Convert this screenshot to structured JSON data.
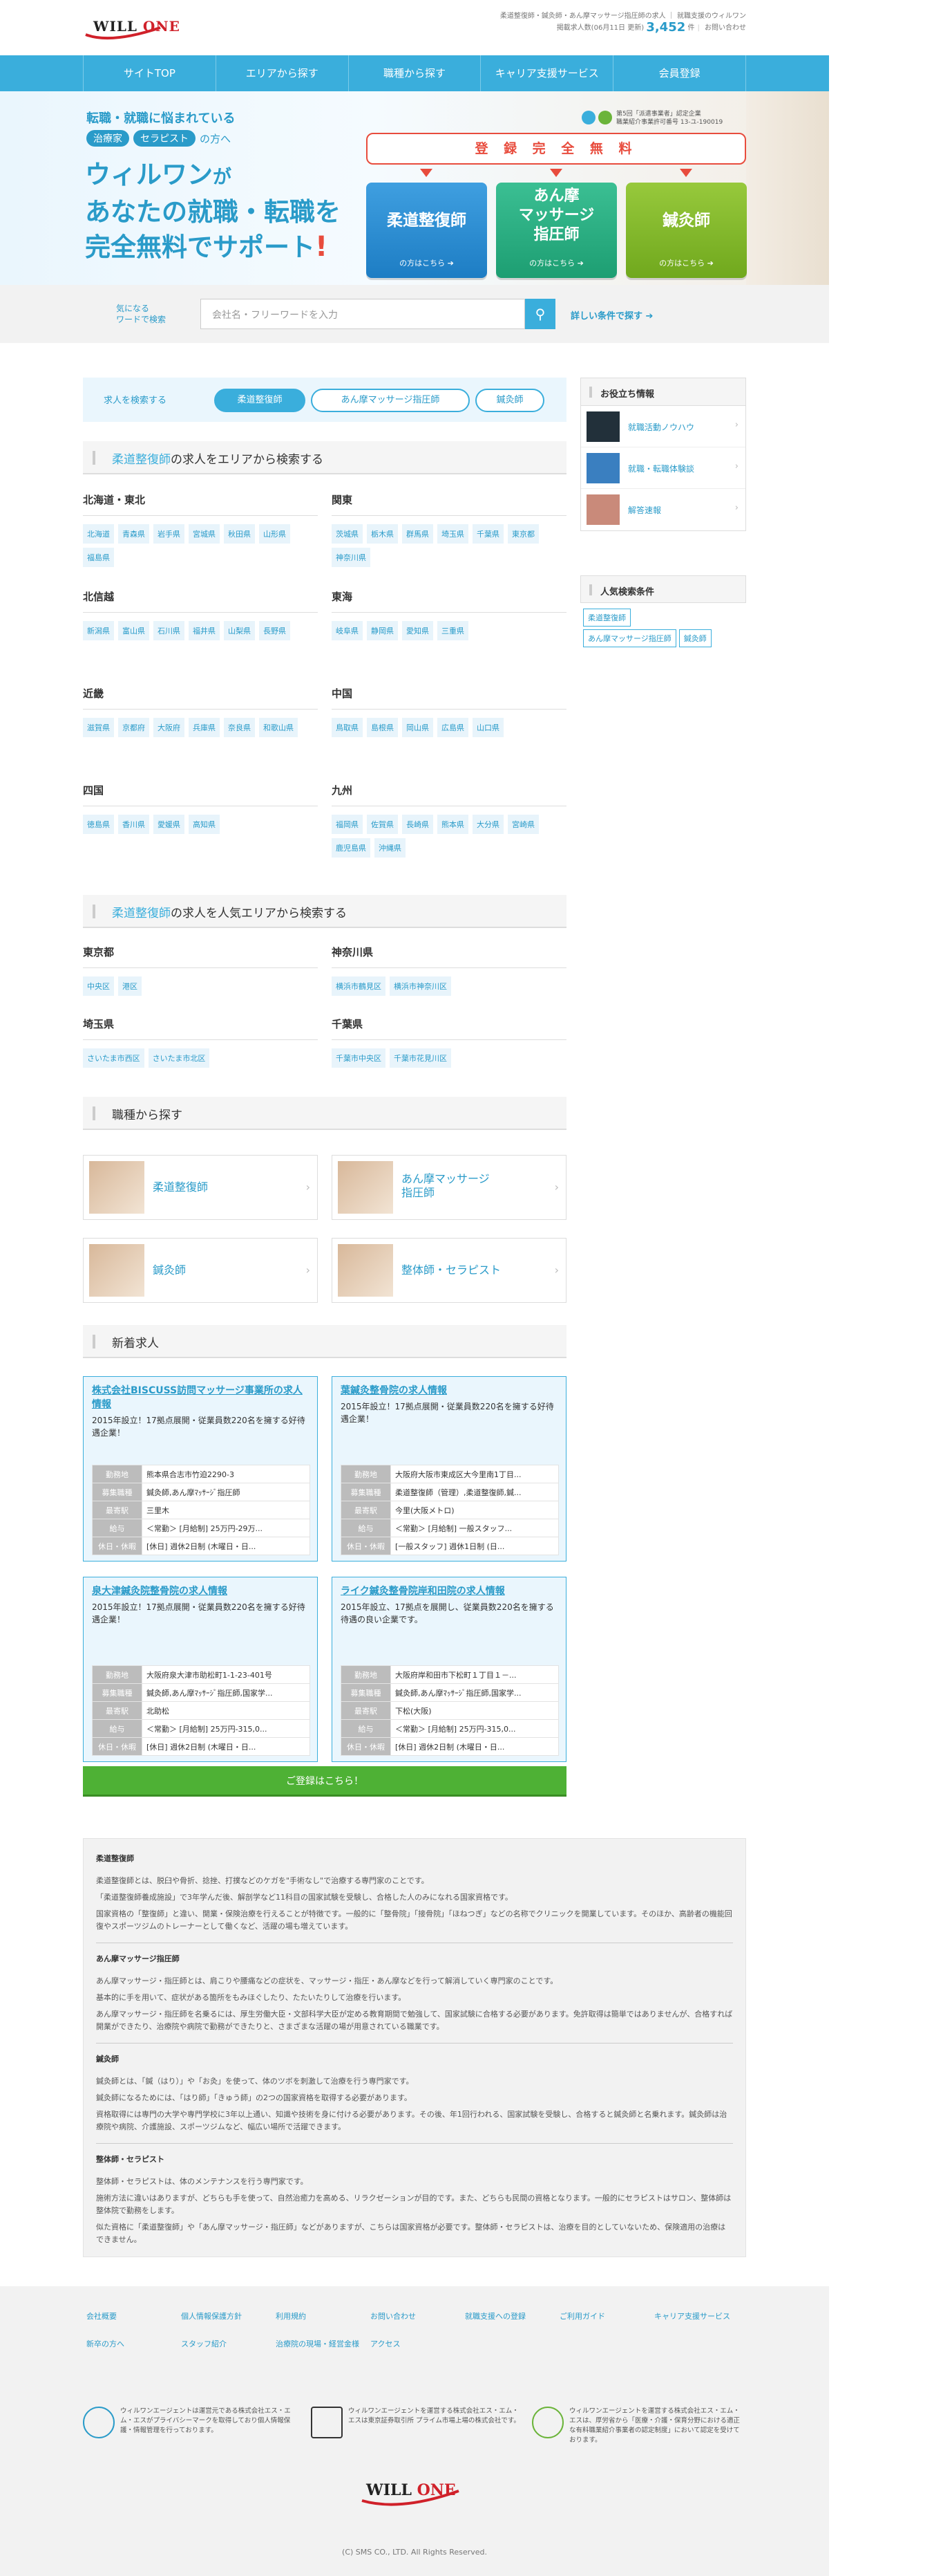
{
  "header": {
    "logo": {
      "word1": "WILL",
      "word2": "ONE"
    },
    "tagline": "柔道整復師・鍼灸師・あん摩マッサージ指圧師の求人 ｜ 就職支援のウィルワン",
    "count_label": "掲載求人数(06月11日 更新)",
    "count_value": "3,452",
    "count_unit": "件",
    "contact": "お問い合わせ"
  },
  "nav": {
    "items": [
      "サイトTOP",
      "エリアから探す",
      "職種から探す",
      "キャリア支援サービス",
      "会員登録"
    ]
  },
  "hero": {
    "line1": "転職・就職に悩まれている",
    "tag1": "治療家",
    "tag2": "セラピスト",
    "line2_tail": "の方へ",
    "big1": "ウィルワン",
    "big1_tail": "が",
    "big2": "あなたの就職・転職を",
    "big3": "完全無料でサポート",
    "big3_bang": "!",
    "cert1": "第5回「派遣事業者」認定企業",
    "cert2": "職業紹介事業許可番号 13-ユ-190019",
    "free": "登 録 完 全 無 料",
    "btn1": {
      "title": "柔道整復師",
      "sub": "の方はこちら"
    },
    "btn2": {
      "title1": "あん摩",
      "title2": "マッサージ",
      "title3": "指圧師",
      "sub": "の方はこちら"
    },
    "btn3": {
      "title": "鍼灸師",
      "sub": "の方はこちら"
    }
  },
  "search": {
    "label1": "気になる",
    "label2": "ワードで検索",
    "placeholder": "会社名・フリーワードを入力",
    "advanced": "詳しい条件で探す"
  },
  "tabs": {
    "label": "求人を検索する",
    "items": [
      "柔道整復師",
      "あん摩マッサージ指圧師",
      "鍼灸師"
    ]
  },
  "area": {
    "title_b": "柔道整復師",
    "title": "の求人をエリアから検索する",
    "regions": [
      {
        "name": "北海道・東北",
        "prefs": [
          "北海道",
          "青森県",
          "岩手県",
          "宮城県",
          "秋田県",
          "山形県",
          "福島県"
        ]
      },
      {
        "name": "関東",
        "prefs": [
          "茨城県",
          "栃木県",
          "群馬県",
          "埼玉県",
          "千葉県",
          "東京都",
          "神奈川県"
        ]
      },
      {
        "name": "北信越",
        "prefs": [
          "新潟県",
          "富山県",
          "石川県",
          "福井県",
          "山梨県",
          "長野県"
        ]
      },
      {
        "name": "東海",
        "prefs": [
          "岐阜県",
          "静岡県",
          "愛知県",
          "三重県"
        ]
      },
      {
        "name": "近畿",
        "prefs": [
          "滋賀県",
          "京都府",
          "大阪府",
          "兵庫県",
          "奈良県",
          "和歌山県"
        ]
      },
      {
        "name": "中国",
        "prefs": [
          "鳥取県",
          "島根県",
          "岡山県",
          "広島県",
          "山口県"
        ]
      },
      {
        "name": "四国",
        "prefs": [
          "徳島県",
          "香川県",
          "愛媛県",
          "高知県"
        ]
      },
      {
        "name": "九州",
        "prefs": [
          "福岡県",
          "佐賀県",
          "長崎県",
          "熊本県",
          "大分県",
          "宮崎県",
          "鹿児島県",
          "沖縄県"
        ]
      }
    ]
  },
  "popular": {
    "title_b": "柔道整復師",
    "title": "の求人を人気エリアから検索する",
    "regions": [
      {
        "name": "東京都",
        "prefs": [
          "中央区",
          "港区"
        ]
      },
      {
        "name": "神奈川県",
        "prefs": [
          "横浜市鶴見区",
          "横浜市神奈川区"
        ]
      },
      {
        "name": "埼玉県",
        "prefs": [
          "さいたま市西区",
          "さいたま市北区"
        ]
      },
      {
        "name": "千葉県",
        "prefs": [
          "千葉市中央区",
          "千葉市花見川区"
        ]
      }
    ]
  },
  "jobtypes": {
    "title": "職種から探す",
    "items": [
      "柔道整復師",
      "あん摩マッサージ",
      "指圧師",
      "鍼灸師",
      "整体師・セラピスト"
    ]
  },
  "newjobs": {
    "title": "新着求人",
    "keys": [
      "勤務地",
      "募集職種",
      "最寄駅",
      "給与",
      "休日・休暇"
    ],
    "cards": [
      {
        "title": "株式会社BISCUSS訪問マッサージ事業所の求人情報",
        "desc": "2015年設立！17拠点展開・従業員数220名を擁する好待遇企業！",
        "rows": [
          "熊本県合志市竹迫2290-3",
          "鍼灸師,あん摩ﾏｯｻｰｼﾞ指圧師",
          "三里木",
          "＜常勤＞ [月給制] 25万円-29万...",
          "[休日] 週休2日制 (木曜日・日..."
        ]
      },
      {
        "title": "葉鍼灸整骨院の求人情報",
        "desc": "2015年設立！17拠点展開・従業員数220名を擁する好待遇企業！",
        "rows": [
          "大阪府大阪市東成区大今里南1丁目...",
          "柔道整復師（管理）,柔道整復師,鍼...",
          "今里(大阪メトロ)",
          "＜常勤＞ [月給制] 一般スタッフ...",
          "[一般スタッフ] 週休1日制 (日..."
        ]
      },
      {
        "title": "泉大津鍼灸院整骨院の求人情報",
        "desc": "2015年設立！17拠点展開・従業員数220名を擁する好待遇企業！",
        "rows": [
          "大阪府泉大津市助松町1-1-23-401号",
          "鍼灸師,あん摩ﾏｯｻｰｼﾞ指圧師,国家学...",
          "北助松",
          "＜常勤＞ [月給制] 25万円-315,0...",
          "[休日] 週休2日制 (木曜日・日..."
        ]
      },
      {
        "title": "ライク鍼灸整骨院岸和田院の求人情報",
        "desc": "2015年設立、17拠点を展開し、従業員数220名を擁する待遇の良い企業です。",
        "rows": [
          "大阪府岸和田市下松町１丁目１－...",
          "鍼灸師,あん摩ﾏｯｻｰｼﾞ指圧師,国家学...",
          "下松(大阪)",
          "＜常勤＞ [月給制] 25万円-315,0...",
          "[休日] 週休2日制 (木曜日・日..."
        ]
      }
    ]
  },
  "cta": "ご登録はこちら！",
  "sidebar": {
    "useful_title": "お役立ち情報",
    "useful": [
      "就職活動ノウハウ",
      "就職・転職体験談",
      "解答速報"
    ],
    "popular_title": "人気検索条件",
    "keywords": [
      "柔道整復師",
      "あん摩マッサージ指圧師",
      "鍼灸師"
    ]
  },
  "desc": {
    "s1_title": "柔道整復師",
    "s1_p1": "柔道整復師とは、脱臼や骨折、捻挫、打撲などのケガを\"手術なし\"で治療する専門家のことです。",
    "s1_p2": "「柔道整復師養成施設」で3年学んだ後、解剖学など11科目の国家試験を受験し、合格した人のみになれる国家資格です。",
    "s1_p3": "国家資格の「整復師」と違い、開業・保険治療を行えることが特徴です。一般的に「整骨院」「接骨院」「ほねつぎ」などの名称でクリニックを開業しています。そのほか、高齢者の機能回復やスポーツジムのトレーナーとして働くなど、活躍の場も増えています。",
    "s2_title": "あん摩マッサージ指圧師",
    "s2_p1": "あん摩マッサージ・指圧師とは、肩こりや腰痛などの症状を、マッサージ・指圧・あん摩などを行って解消していく専門家のことです。",
    "s2_p2": "基本的に手を用いて、症状がある箇所をもみほぐしたり、たたいたりして治療を行います。",
    "s2_p3": "あん摩マッサージ・指圧師を名乗るには、厚生労働大臣・文部科学大臣が定める教育期間で勉強して、国家試験に合格する必要があります。免許取得は簡単ではありませんが、合格すれば開業ができたり、治療院や病院で勤務ができたりと、さまざまな活躍の場が用意されている職業です。",
    "s3_title": "鍼灸師",
    "s3_p1": "鍼灸師とは、「鍼（はり）」や「お灸」を使って、体のツボを刺激して治療を行う専門家です。",
    "s3_p2": "鍼灸師になるためには、「はり師」「きゅう師」の2つの国家資格を取得する必要があります。",
    "s3_p3": "資格取得には専門の大学や専門学校に3年以上通い、知識や技術を身に付ける必要があります。その後、年1回行われる、国家試験を受験し、合格すると鍼灸師と名乗れます。鍼灸師は治療院や病院、介護施設、スポーツジムなど、幅広い場所で活躍できます。",
    "s4_title": "整体師・セラピスト",
    "s4_p1": "整体師・セラピストは、体のメンテナンスを行う専門家です。",
    "s4_p2": "施術方法に違いはありますが、どちらも手を使って、自然治癒力を高める、リラクゼーションが目的です。また、どちらも民間の資格となります。一般的にセラピストはサロン、整体師は整体院で勤務をします。",
    "s4_p3": "似た資格に「柔道整復師」や「あん摩マッサージ・指圧師」などがありますが、こちらは国家資格が必要です。整体師・セラピストは、治療を目的としていないため、保険適用の治療はできません。"
  },
  "footer": {
    "links": [
      "会社概要",
      "個人情報保護方針",
      "利用規約",
      "お問い合わせ",
      "就職支援への登録",
      "ご利用ガイド",
      "キャリア支援サービス",
      "新卒の方へ",
      "スタッフ紹介",
      "治療院の現場・経営金様",
      "アクセス"
    ],
    "badge1": "ウィルワンエージェントは運営元である株式会社エス・エム・エスがプライバシーマークを取得しており個人情報保護・情報管理を行っております。",
    "badge2": "ウィルワンエージェントを運営する株式会社エス・エム・エスは東京証券取引所 プライム市場上場の株式会社です。",
    "badge3": "ウィルワンエージェントを運営する株式会社エス・エム・エスは、厚労省から「医療・介護・保育分野における適正な有料職業紹介事業者の認定制度」において認定を受けております。",
    "logo": {
      "word1": "WILL",
      "word2": "ONE"
    },
    "copyright": "(C) SMS CO., LTD. All Rights Reserved."
  }
}
